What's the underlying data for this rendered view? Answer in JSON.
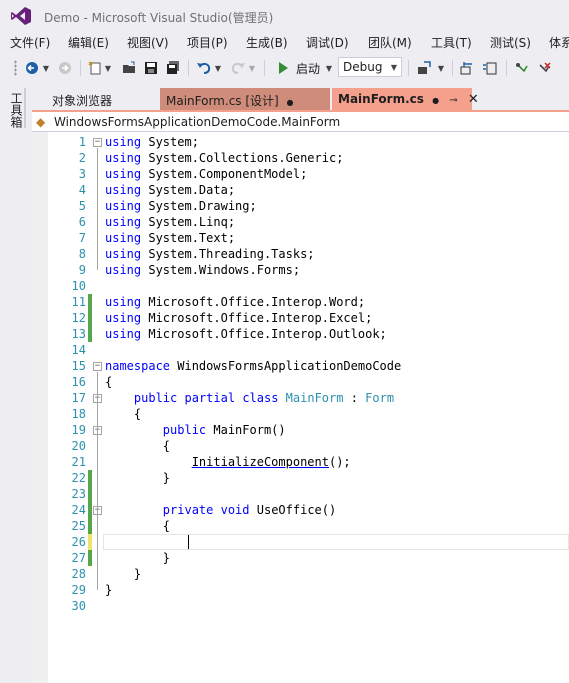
{
  "window": {
    "title": "Demo - Microsoft Visual Studio(管理员)"
  },
  "menu": [
    "文件(F)",
    "编辑(E)",
    "视图(V)",
    "项目(P)",
    "生成(B)",
    "调试(D)",
    "团队(M)",
    "工具(T)",
    "测试(S)",
    "体系"
  ],
  "toolbar": {
    "start_label": "启动",
    "configuration": "Debug"
  },
  "toolbox": {
    "label": "工具箱"
  },
  "tabs": [
    {
      "label": "对象浏览器"
    },
    {
      "label": "MainForm.cs [设计]"
    },
    {
      "label": "MainForm.cs",
      "pin": "⊸",
      "close": "✕"
    }
  ],
  "navbar": {
    "path": "WindowsFormsApplicationDemoCode.MainForm"
  },
  "colors": {
    "keyword": "#0000ff",
    "type": "#2b91af",
    "tab_active": "#f5a08c",
    "change_saved": "#57a64a",
    "change_unsaved": "#efe46b"
  },
  "code": [
    {
      "n": "1",
      "fold": "−",
      "chg": "",
      "tokens": [
        [
          "kw",
          "using"
        ],
        [
          "pl",
          " System;"
        ]
      ]
    },
    {
      "n": "2",
      "fold": "",
      "chg": "",
      "tokens": [
        [
          "kw",
          "using"
        ],
        [
          "pl",
          " System.Collections.Generic;"
        ]
      ]
    },
    {
      "n": "3",
      "fold": "",
      "chg": "",
      "tokens": [
        [
          "kw",
          "using"
        ],
        [
          "pl",
          " System.ComponentModel;"
        ]
      ]
    },
    {
      "n": "4",
      "fold": "",
      "chg": "",
      "tokens": [
        [
          "kw",
          "using"
        ],
        [
          "pl",
          " System.Data;"
        ]
      ]
    },
    {
      "n": "5",
      "fold": "",
      "chg": "",
      "tokens": [
        [
          "kw",
          "using"
        ],
        [
          "pl",
          " System.Drawing;"
        ]
      ]
    },
    {
      "n": "6",
      "fold": "",
      "chg": "",
      "tokens": [
        [
          "kw",
          "using"
        ],
        [
          "pl",
          " System.Linq;"
        ]
      ]
    },
    {
      "n": "7",
      "fold": "",
      "chg": "",
      "tokens": [
        [
          "kw",
          "using"
        ],
        [
          "pl",
          " System.Text;"
        ]
      ]
    },
    {
      "n": "8",
      "fold": "",
      "chg": "",
      "tokens": [
        [
          "kw",
          "using"
        ],
        [
          "pl",
          " System.Threading.Tasks;"
        ]
      ]
    },
    {
      "n": "9",
      "fold": "",
      "chg": "",
      "tokens": [
        [
          "kw",
          "using"
        ],
        [
          "pl",
          " System.Windows.Forms;"
        ]
      ]
    },
    {
      "n": "10",
      "fold": "",
      "chg": "",
      "tokens": []
    },
    {
      "n": "11",
      "fold": "",
      "chg": "green",
      "tokens": [
        [
          "kw",
          "using"
        ],
        [
          "pl",
          " Microsoft.Office.Interop.Word;"
        ]
      ]
    },
    {
      "n": "12",
      "fold": "",
      "chg": "green",
      "tokens": [
        [
          "kw",
          "using"
        ],
        [
          "pl",
          " Microsoft.Office.Interop.Excel;"
        ]
      ]
    },
    {
      "n": "13",
      "fold": "",
      "chg": "green",
      "tokens": [
        [
          "kw",
          "using"
        ],
        [
          "pl",
          " Microsoft.Office.Interop.Outlook;"
        ]
      ]
    },
    {
      "n": "14",
      "fold": "",
      "chg": "",
      "tokens": []
    },
    {
      "n": "15",
      "fold": "−",
      "chg": "",
      "tokens": [
        [
          "kw",
          "namespace"
        ],
        [
          "pl",
          " WindowsFormsApplicationDemoCode"
        ]
      ]
    },
    {
      "n": "16",
      "fold": "",
      "chg": "",
      "tokens": [
        [
          "pl",
          "{"
        ]
      ]
    },
    {
      "n": "17",
      "fold": "−",
      "chg": "",
      "tokens": [
        [
          "pl",
          "    "
        ],
        [
          "kw",
          "public"
        ],
        [
          "pl",
          " "
        ],
        [
          "kw",
          "partial"
        ],
        [
          "pl",
          " "
        ],
        [
          "kw",
          "class"
        ],
        [
          "pl",
          " "
        ],
        [
          "ty",
          "MainForm"
        ],
        [
          "pl",
          " : "
        ],
        [
          "ty",
          "Form"
        ]
      ]
    },
    {
      "n": "18",
      "fold": "",
      "chg": "",
      "tokens": [
        [
          "pl",
          "    {"
        ]
      ]
    },
    {
      "n": "19",
      "fold": "−",
      "chg": "",
      "tokens": [
        [
          "pl",
          "        "
        ],
        [
          "kw",
          "public"
        ],
        [
          "pl",
          " MainForm()"
        ]
      ]
    },
    {
      "n": "20",
      "fold": "",
      "chg": "",
      "tokens": [
        [
          "pl",
          "        {"
        ]
      ]
    },
    {
      "n": "21",
      "fold": "",
      "chg": "",
      "tokens": [
        [
          "pl",
          "            "
        ],
        [
          "method",
          "InitializeComponent"
        ],
        [
          "pl",
          "();"
        ]
      ]
    },
    {
      "n": "22",
      "fold": "",
      "chg": "green",
      "tokens": [
        [
          "pl",
          "        }"
        ]
      ]
    },
    {
      "n": "23",
      "fold": "",
      "chg": "green",
      "tokens": []
    },
    {
      "n": "24",
      "fold": "−",
      "chg": "green",
      "tokens": [
        [
          "pl",
          "        "
        ],
        [
          "kw",
          "private"
        ],
        [
          "pl",
          " "
        ],
        [
          "kw",
          "void"
        ],
        [
          "pl",
          " UseOffice()"
        ]
      ]
    },
    {
      "n": "25",
      "fold": "",
      "chg": "green",
      "tokens": [
        [
          "pl",
          "        {"
        ]
      ]
    },
    {
      "n": "26",
      "fold": "",
      "chg": "yellow",
      "tokens": []
    },
    {
      "n": "27",
      "fold": "",
      "chg": "green",
      "tokens": [
        [
          "pl",
          "        }"
        ]
      ]
    },
    {
      "n": "28",
      "fold": "",
      "chg": "",
      "tokens": [
        [
          "pl",
          "    }"
        ]
      ]
    },
    {
      "n": "29",
      "fold": "",
      "chg": "",
      "tokens": [
        [
          "pl",
          "}"
        ]
      ]
    },
    {
      "n": "30",
      "fold": "",
      "chg": "",
      "tokens": []
    }
  ]
}
